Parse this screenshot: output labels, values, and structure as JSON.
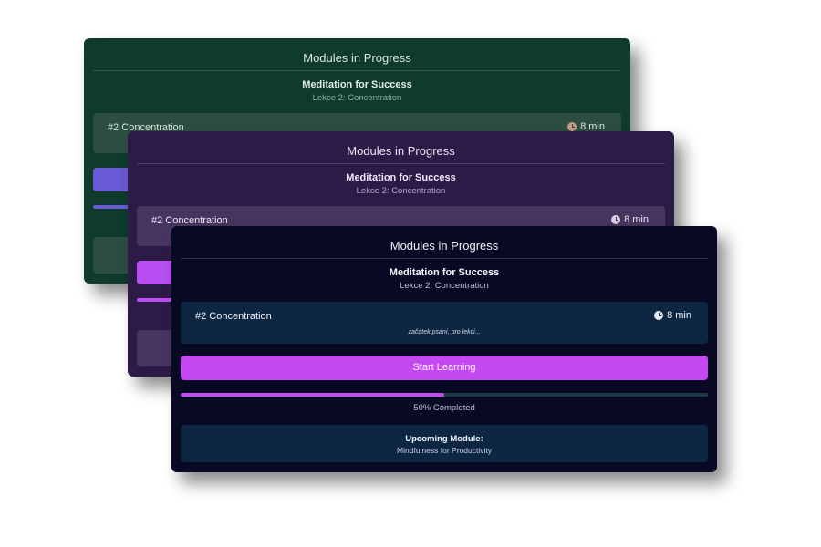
{
  "theme": {
    "green_bg": "#0f3b2c",
    "purple_bg": "#2d1b47",
    "navy_bg": "#070a22",
    "accent_violet": "#6b5ad6",
    "accent_magenta": "#c449f0"
  },
  "cards": [
    {
      "title": "Modules in Progress",
      "course": "Meditation for Success",
      "lesson": "Lekce 2: Concentration",
      "lesson_name": "#2 Concentration",
      "duration": "8 min",
      "icon": "clock-icon"
    },
    {
      "title": "Modules in Progress",
      "course": "Meditation for Success",
      "lesson": "Lekce 2: Concentration",
      "lesson_name": "#2 Concentration",
      "duration": "8 min",
      "icon": "clock-icon"
    },
    {
      "title": "Modules in Progress",
      "course": "Meditation for Success",
      "lesson": "Lekce 2: Concentration",
      "lesson_name": "#2 Concentration",
      "duration": "8 min",
      "note": "začátek psaní, pro lekci...",
      "icon": "clock-icon",
      "button_label": "Start Learning",
      "progress": 0.5,
      "progress_text": "50% Completed",
      "upcoming_title": "Upcoming Module:",
      "upcoming_name": "Mindfulness for Productivity"
    }
  ]
}
